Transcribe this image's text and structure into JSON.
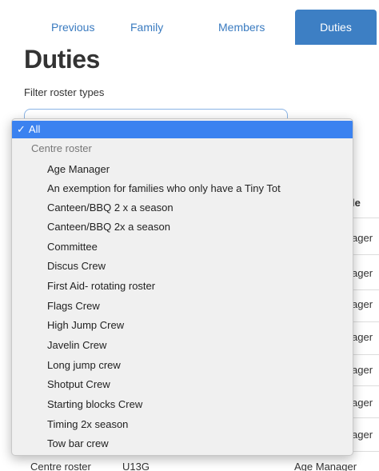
{
  "tabs": {
    "previous": "Previous",
    "family": "Family",
    "members": "Members",
    "duties": "Duties"
  },
  "page_title": "Duties",
  "filter_label": "Filter roster types",
  "dropdown": {
    "selected_label": "All",
    "check_mark": "✓",
    "group_label": "Centre roster",
    "options": [
      "Age Manager",
      "An exemption for families who only have a Tiny Tot",
      "Canteen/BBQ 2 x a season",
      "Canteen/BBQ 2x a season",
      "Committee",
      "Discus Crew",
      "First Aid- rotating roster",
      "Flags Crew",
      "High Jump Crew",
      "Javelin Crew",
      "Long jump crew",
      "Shotput Crew",
      "Starting blocks Crew",
      "Timing 2x season",
      "Tow bar crew"
    ]
  },
  "background_table": {
    "header_fragment": "le",
    "cell_fragment": "ager",
    "last_row": {
      "roster": "Centre roster",
      "group": "U13G",
      "role": "Age Manager"
    }
  },
  "colors": {
    "accent": "#3d7fc4",
    "selection": "#3b82f0"
  }
}
